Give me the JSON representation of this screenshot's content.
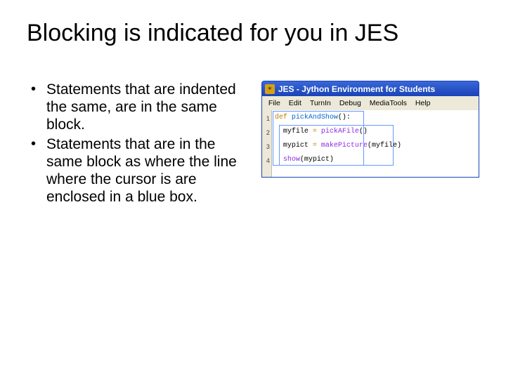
{
  "title": "Blocking is indicated for you in JES",
  "bullets": [
    "Statements that are indented the same, are in the same block.",
    "Statements that are in the same block as where the line where the cursor is are enclosed in a blue box."
  ],
  "app": {
    "title": "JES - Jython Environment for Students",
    "icon_glyph": "✶",
    "menus": [
      "File",
      "Edit",
      "TurnIn",
      "Debug",
      "MediaTools",
      "Help"
    ],
    "gutter": [
      "1",
      "2",
      "3",
      "4"
    ],
    "code": {
      "line1": {
        "def": "def ",
        "fn": "pickAndShow",
        "paren": "():"
      },
      "line2": {
        "indent": "  ",
        "var": "myfile ",
        "eq": "= ",
        "call": "pickAFile",
        "paren2": "()"
      },
      "line3": {
        "indent": "  ",
        "var": "mypict ",
        "eq": "= ",
        "call": "makePicture",
        "paren_open": "(",
        "arg": "myfile",
        "paren_close": ")"
      },
      "line4": {
        "indent": "  ",
        "call": "show",
        "paren_open": "(",
        "arg": "mypict",
        "paren_close": ")"
      }
    }
  }
}
